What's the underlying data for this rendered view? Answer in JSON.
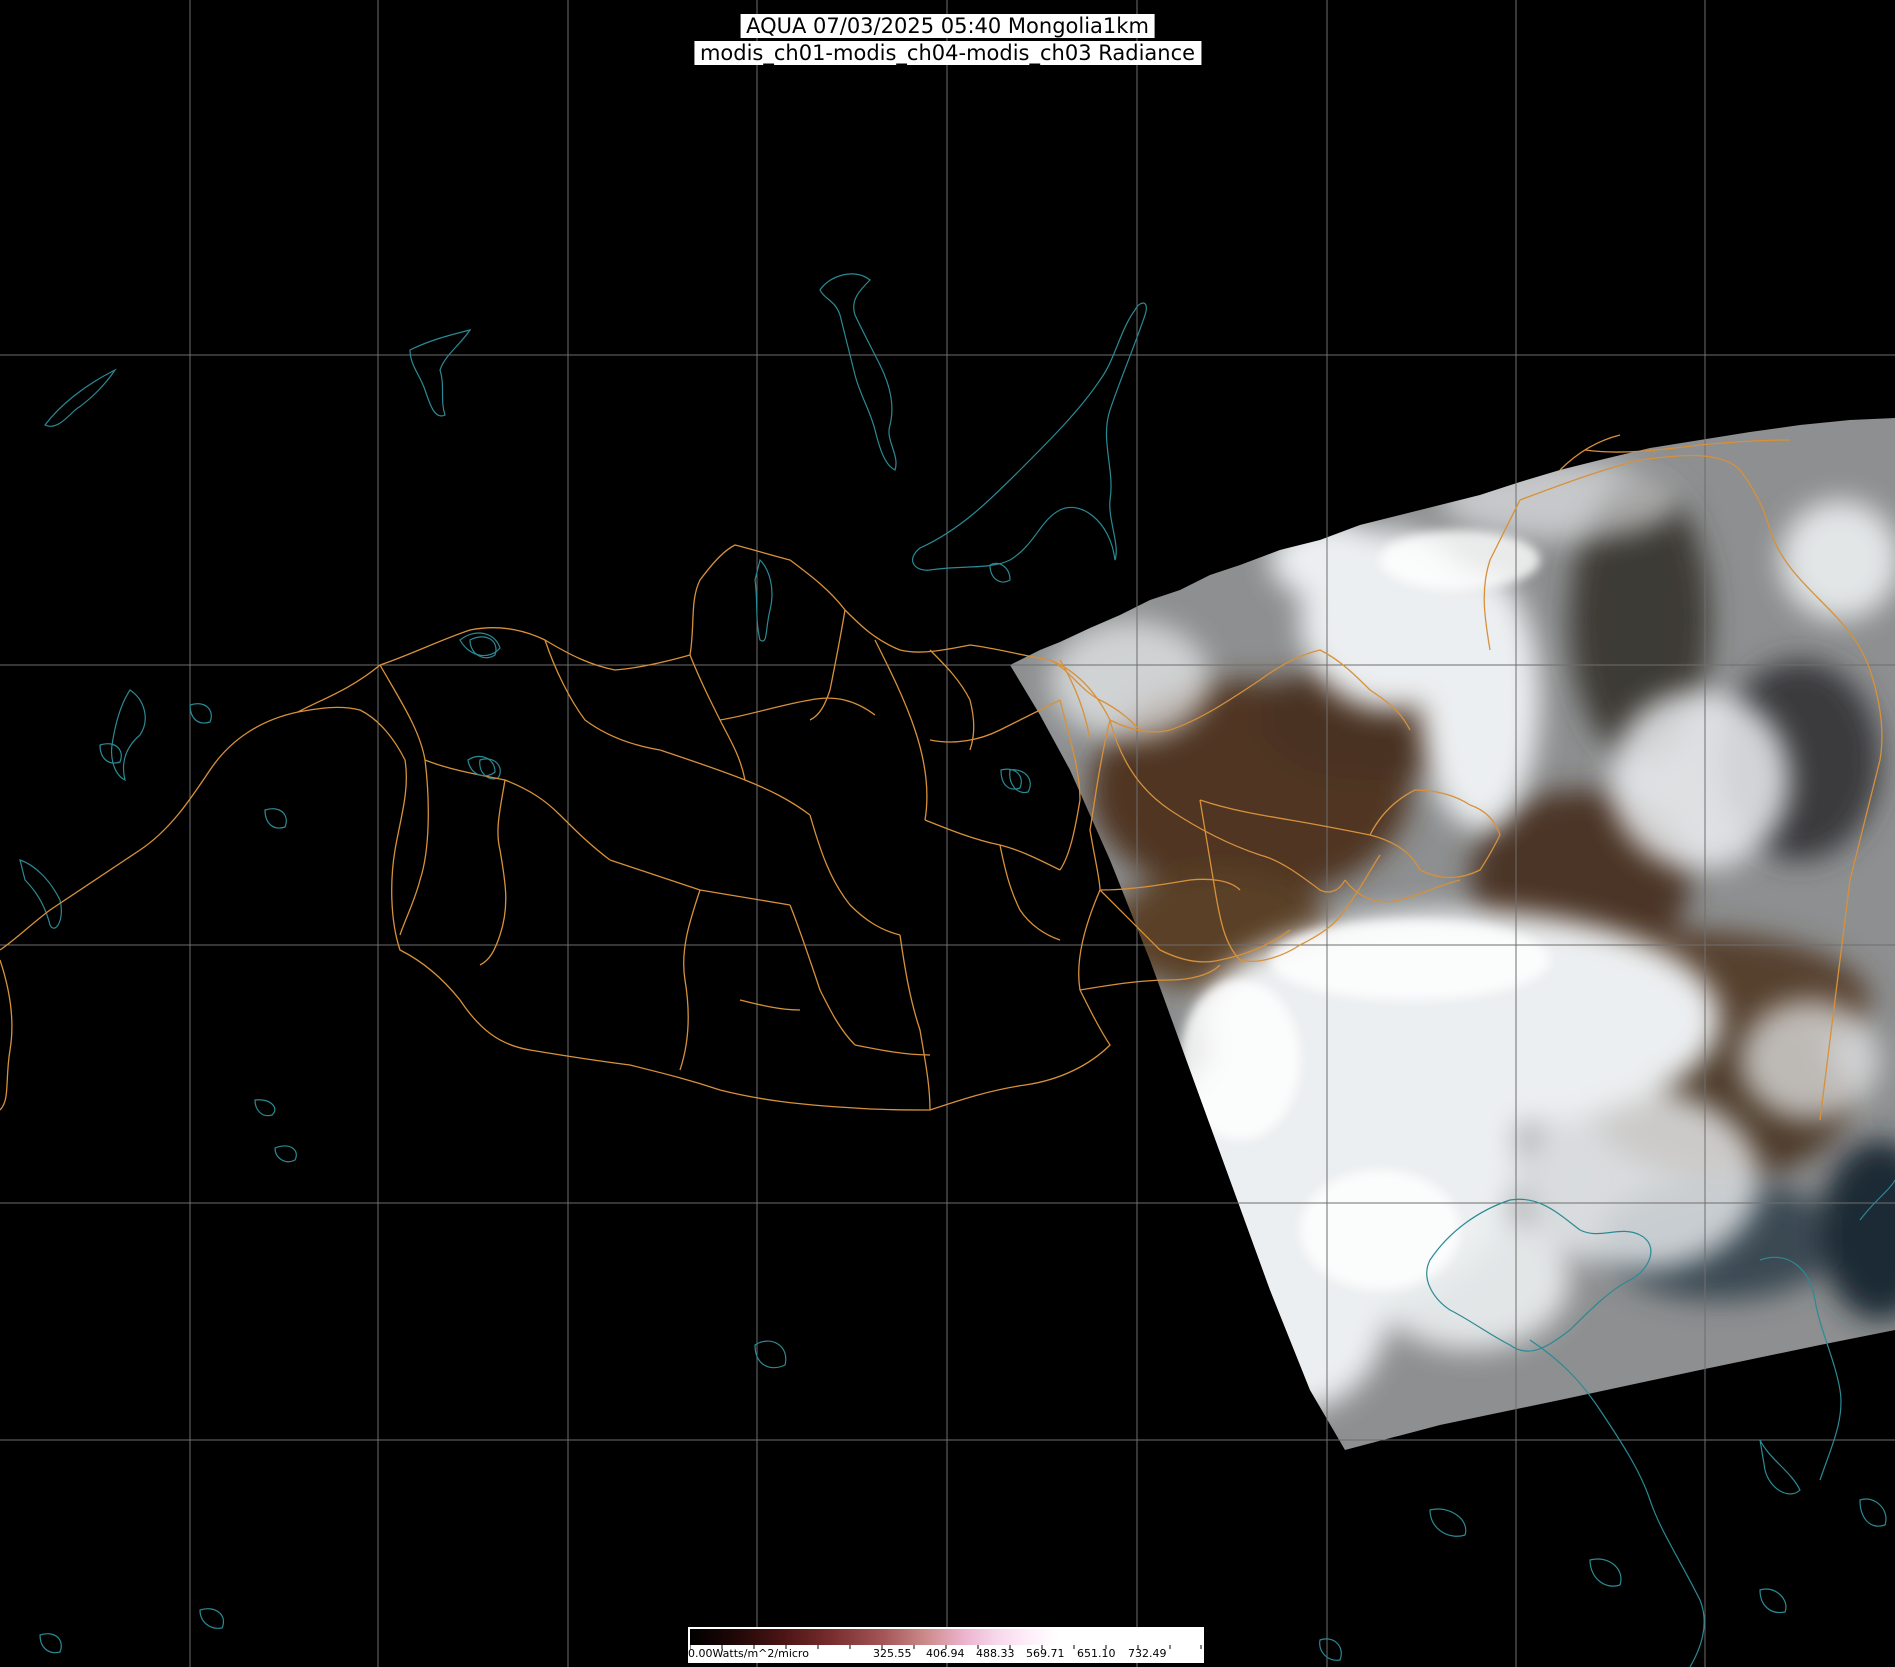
{
  "title": {
    "line1": "AQUA 07/03/2025 05:40 Mongolia1km",
    "line2": "modis_ch01-modis_ch04-modis_ch03 Radiance"
  },
  "colorbar": {
    "unit_label": "0.00Watts/m^2/micro",
    "tick_labels": [
      "325.55",
      "406.94",
      "488.33",
      "569.71",
      "651.10",
      "732.49"
    ]
  },
  "colors": {
    "background": "#000000",
    "graticule": "#6e6e6e",
    "admin_borders": "#d7913a",
    "coast_lakes": "#2a8a94",
    "snow_cloud": "#e8ecef",
    "bare_land": "#5a3f28"
  },
  "map_layers": [
    "graticule",
    "admin-borders",
    "coastlines-lakes",
    "satellite-swath"
  ]
}
